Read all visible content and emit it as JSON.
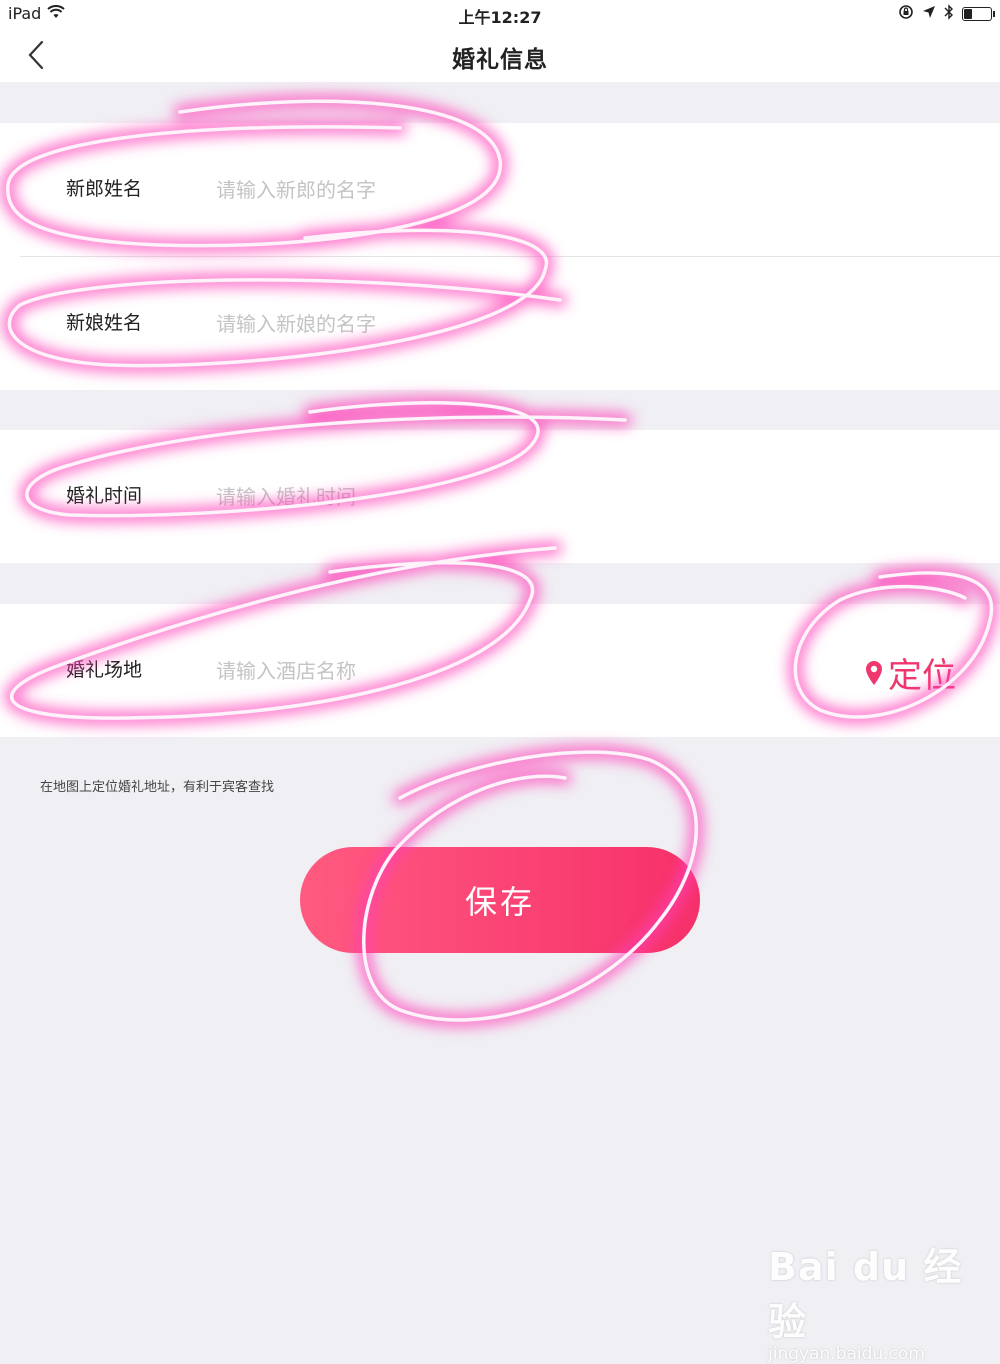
{
  "status_bar": {
    "device": "iPad",
    "time": "上午12:27"
  },
  "nav": {
    "title": "婚礼信息"
  },
  "form": {
    "groom_label": "新郎姓名",
    "groom_placeholder": "请输入新郎的名字",
    "bride_label": "新娘姓名",
    "bride_placeholder": "请输入新娘的名字",
    "time_label": "婚礼时间",
    "time_placeholder": "请输入婚礼时间",
    "venue_label": "婚礼场地",
    "venue_placeholder": "请输入酒店名称",
    "locate_label": "定位"
  },
  "hint": "在地图上定位婚礼地址，有利于宾客查找",
  "save_label": "保存",
  "watermark": {
    "logo": "Bai du 经验",
    "url": "jingyan.baidu.com"
  },
  "colors": {
    "accent": "#f0376d",
    "annotation": "#ff3fb8"
  }
}
